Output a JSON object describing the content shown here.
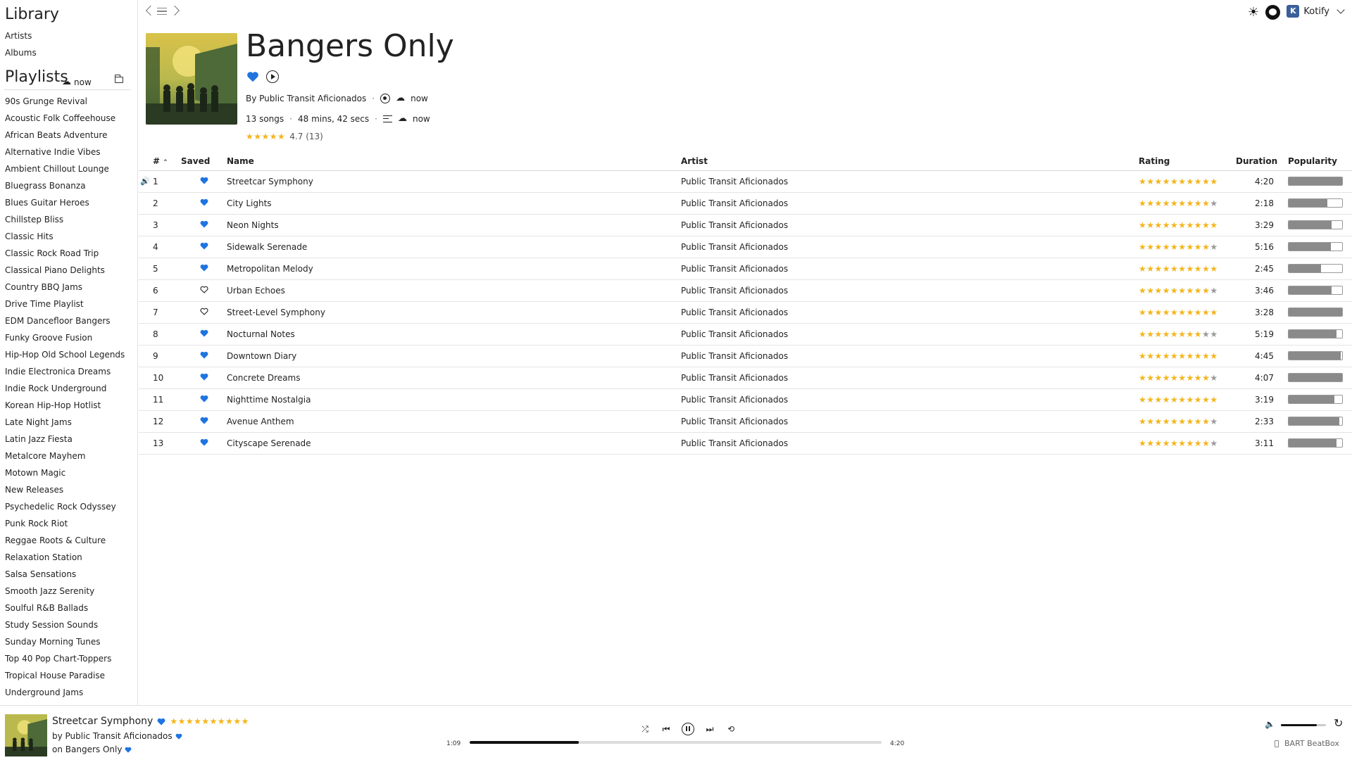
{
  "sidebar": {
    "library_title": "Library",
    "library_links": [
      "Artists",
      "Albums"
    ],
    "playlists_title": "Playlists",
    "playlists_sync": "now",
    "playlists": [
      "90s Grunge Revival",
      "Acoustic Folk Coffeehouse",
      "African Beats Adventure",
      "Alternative Indie Vibes",
      "Ambient Chillout Lounge",
      "Bluegrass Bonanza",
      "Blues Guitar Heroes",
      "Chillstep Bliss",
      "Classic Hits",
      "Classic Rock Road Trip",
      "Classical Piano Delights",
      "Country BBQ Jams",
      "Drive Time Playlist",
      "EDM Dancefloor Bangers",
      "Funky Groove Fusion",
      "Hip-Hop Old School Legends",
      "Indie Electronica Dreams",
      "Indie Rock Underground",
      "Korean Hip-Hop Hotlist",
      "Late Night Jams",
      "Latin Jazz Fiesta",
      "Metalcore Mayhem",
      "Motown Magic",
      "New Releases",
      "Psychedelic Rock Odyssey",
      "Punk Rock Riot",
      "Reggae Roots & Culture",
      "Relaxation Station",
      "Salsa Sensations",
      "Smooth Jazz Serenity",
      "Soulful R&B Ballads",
      "Study Session Sounds",
      "Sunday Morning Tunes",
      "Top 40 Pop Chart-Toppers",
      "Tropical House Paradise",
      "Underground Jams"
    ]
  },
  "topbar": {
    "user_initial": "K",
    "user_name": "Kotify",
    "icons": [
      "back-arrow",
      "list",
      "forward-arrow",
      "sun",
      "github"
    ]
  },
  "playlist": {
    "title": "Bangers Only",
    "owner": "By Public Transit Aficionados",
    "owner_sync": "now",
    "song_count": "13 songs",
    "length": "48 mins, 42 secs",
    "queue_sync": "now",
    "rating_value": "4.7 (13)",
    "rating_stars": 5
  },
  "table": {
    "headers": {
      "num": "#",
      "saved": "Saved",
      "name": "Name",
      "artist": "Artist",
      "rating": "Rating",
      "duration": "Duration",
      "popularity": "Popularity"
    },
    "rows": [
      {
        "num": "1",
        "saved": true,
        "name": "Streetcar Symphony",
        "artist": "Public Transit Aficionados",
        "rating": 10,
        "duration": "4:20",
        "popularity": 1.0,
        "playing": true
      },
      {
        "num": "2",
        "saved": true,
        "name": "City Lights",
        "artist": "Public Transit Aficionados",
        "rating": 9,
        "duration": "2:18",
        "popularity": 0.73
      },
      {
        "num": "3",
        "saved": true,
        "name": "Neon Nights",
        "artist": "Public Transit Aficionados",
        "rating": 10,
        "duration": "3:29",
        "popularity": 0.8
      },
      {
        "num": "4",
        "saved": true,
        "name": "Sidewalk Serenade",
        "artist": "Public Transit Aficionados",
        "rating": 9,
        "duration": "5:16",
        "popularity": 0.79
      },
      {
        "num": "5",
        "saved": true,
        "name": "Metropolitan Melody",
        "artist": "Public Transit Aficionados",
        "rating": 10,
        "duration": "2:45",
        "popularity": 0.6
      },
      {
        "num": "6",
        "saved": false,
        "name": "Urban Echoes",
        "artist": "Public Transit Aficionados",
        "rating": 9,
        "duration": "3:46",
        "popularity": 0.8
      },
      {
        "num": "7",
        "saved": false,
        "name": "Street-Level Symphony",
        "artist": "Public Transit Aficionados",
        "rating": 10,
        "duration": "3:28",
        "popularity": 1.0
      },
      {
        "num": "8",
        "saved": true,
        "name": "Nocturnal Notes",
        "artist": "Public Transit Aficionados",
        "rating": 8,
        "duration": "5:19",
        "popularity": 0.89
      },
      {
        "num": "9",
        "saved": true,
        "name": "Downtown Diary",
        "artist": "Public Transit Aficionados",
        "rating": 10,
        "duration": "4:45",
        "popularity": 0.97
      },
      {
        "num": "10",
        "saved": true,
        "name": "Concrete Dreams",
        "artist": "Public Transit Aficionados",
        "rating": 9,
        "duration": "4:07",
        "popularity": 1.0
      },
      {
        "num": "11",
        "saved": true,
        "name": "Nighttime Nostalgia",
        "artist": "Public Transit Aficionados",
        "rating": 10,
        "duration": "3:19",
        "popularity": 0.85
      },
      {
        "num": "12",
        "saved": true,
        "name": "Avenue Anthem",
        "artist": "Public Transit Aficionados",
        "rating": 9,
        "duration": "2:33",
        "popularity": 0.95
      },
      {
        "num": "13",
        "saved": true,
        "name": "Cityscape Serenade",
        "artist": "Public Transit Aficionados",
        "rating": 9,
        "duration": "3:11",
        "popularity": 0.9
      }
    ]
  },
  "player": {
    "title": "Streetcar Symphony",
    "rating_stars": 10,
    "artist_line": "by Public Transit Aficionados",
    "album_line": "on Bangers Only",
    "time_current": "1:09",
    "time_total": "4:20",
    "progress": 0.265,
    "volume": 0.8,
    "device": "BART BeatBox"
  },
  "colors": {
    "accent": "#1f74e0",
    "star": "#f3b51b",
    "star_off": "#9a9a9a",
    "popularity": "#8a8a8a"
  }
}
